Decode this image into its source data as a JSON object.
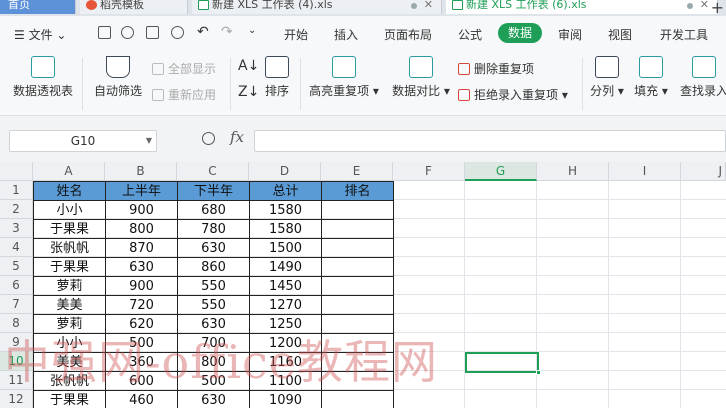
{
  "tabs": [
    {
      "label": "首页"
    },
    {
      "label": "稻壳模板"
    },
    {
      "label": "新建 XLS 工作表 (4).xls"
    },
    {
      "label": "新建 XLS 工作表 (6).xls"
    }
  ],
  "menu": {
    "file_label": "文件",
    "items": [
      "开始",
      "插入",
      "页面布局",
      "公式",
      "数据",
      "审阅",
      "视图",
      "开发工具"
    ],
    "active": "数据"
  },
  "ribbon": {
    "pivot": "数据透视表",
    "autofilter": "自动筛选",
    "show_all": "全部显示",
    "reapply": "重新应用",
    "sort": "排序",
    "highlight_dup": "高亮重复项",
    "data_compare": "数据对比",
    "remove_dup": "删除重复项",
    "reject_dup": "拒绝录入重复项",
    "split": "分列",
    "fill": "填充",
    "lookup": "查找录入"
  },
  "formula_bar": {
    "name_box": "G10",
    "fx_label": "fx",
    "formula": ""
  },
  "grid": {
    "columns": [
      "A",
      "B",
      "C",
      "D",
      "E",
      "F",
      "G",
      "H",
      "I",
      "J"
    ],
    "rows": [
      "1",
      "2",
      "3",
      "4",
      "5",
      "6",
      "7",
      "8",
      "9",
      "10",
      "11",
      "12"
    ],
    "selected_cell": "G10",
    "table": {
      "header": [
        "姓名",
        "上半年",
        "下半年",
        "总计",
        "排名"
      ],
      "rows": [
        [
          "小小",
          "900",
          "680",
          "1580",
          ""
        ],
        [
          "于果果",
          "800",
          "780",
          "1580",
          ""
        ],
        [
          "张帆帆",
          "870",
          "630",
          "1500",
          ""
        ],
        [
          "于果果",
          "630",
          "860",
          "1490",
          ""
        ],
        [
          "萝莉",
          "900",
          "550",
          "1450",
          ""
        ],
        [
          "美美",
          "720",
          "550",
          "1270",
          ""
        ],
        [
          "萝莉",
          "620",
          "630",
          "1250",
          ""
        ],
        [
          "小小",
          "500",
          "700",
          "1200",
          ""
        ],
        [
          "美美",
          "360",
          "800",
          "1160",
          ""
        ],
        [
          "张帆帆",
          "600",
          "500",
          "1100",
          ""
        ],
        [
          "于果果",
          "460",
          "630",
          "1090",
          ""
        ]
      ]
    }
  },
  "watermark": "中强网-office教程网"
}
